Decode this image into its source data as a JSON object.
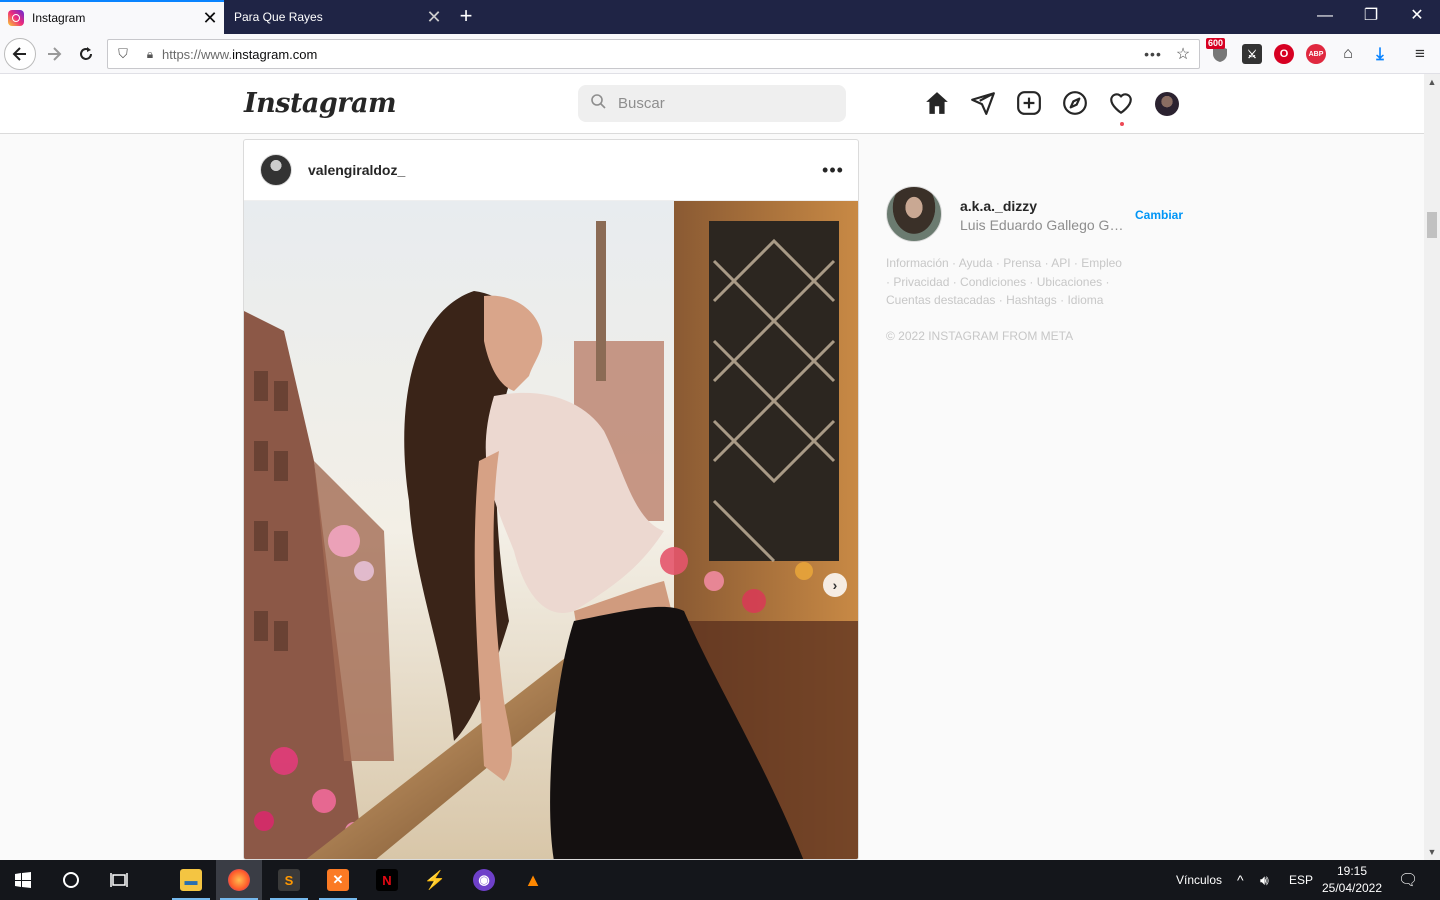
{
  "browser": {
    "tabs": [
      {
        "title": "Instagram",
        "active": true
      },
      {
        "title": "Para Que Rayes",
        "active": false
      }
    ],
    "url_prefix": "https://www.",
    "url_host": "instagram.com",
    "extension_badge": "600"
  },
  "instagram": {
    "logo_text": "Instagram",
    "search_placeholder": "Buscar",
    "nav_icons": [
      "home-icon",
      "direct-icon",
      "new-post-icon",
      "explore-icon",
      "activity-heart-icon",
      "profile-avatar"
    ],
    "post": {
      "username": "valengiraldoz_",
      "more_label": "•••"
    },
    "sidebar": {
      "username": "a.k.a._dizzy",
      "full_name": "Luis Eduardo Gallego Garcia",
      "switch_label": "Cambiar"
    },
    "footer_links": [
      "Información",
      "Ayuda",
      "Prensa",
      "API",
      "Empleo",
      "Privacidad",
      "Condiciones",
      "Ubicaciones",
      "Cuentas destacadas",
      "Hashtags",
      "Idioma"
    ],
    "copyright": "© 2022 INSTAGRAM FROM META"
  },
  "taskbar": {
    "links_label": "Vínculos",
    "language": "ESP",
    "time": "19:15",
    "date": "25/04/2022"
  },
  "colors": {
    "accent_blue": "#0095f6",
    "notification_red": "#ed4956",
    "tabbar_bg": "#1f2445"
  }
}
